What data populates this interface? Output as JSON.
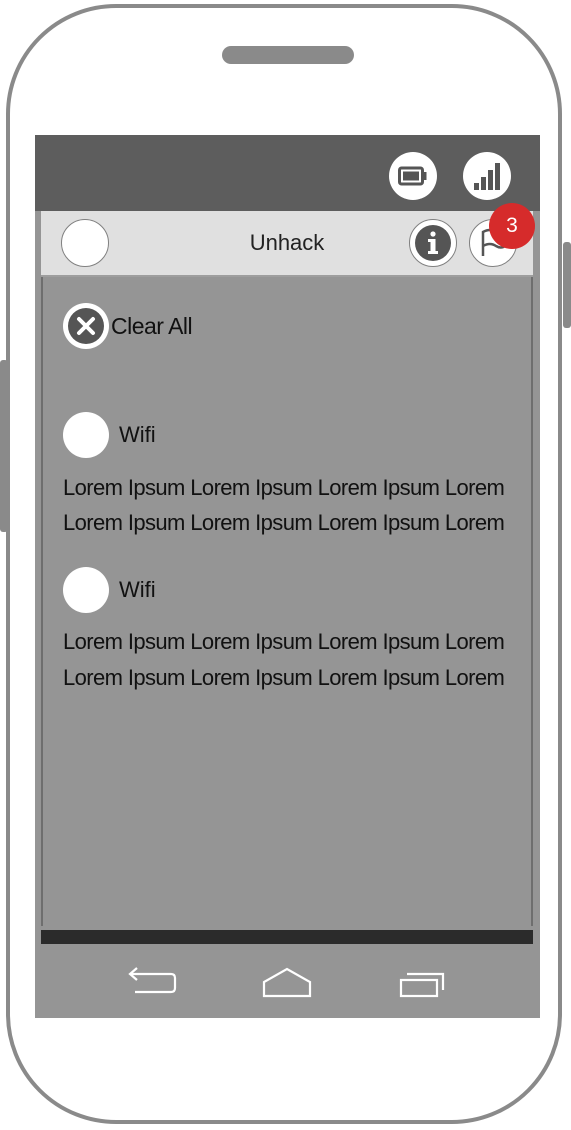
{
  "status_bar": {
    "icons": [
      "battery-icon",
      "signal-icon"
    ]
  },
  "app_bar": {
    "title": "Unhack",
    "info_icon": "info-icon",
    "notifications_icon": "flag-icon",
    "notification_badge": "3",
    "badge_color": "#d62b2b"
  },
  "actions": {
    "clear_all_label": "Clear All",
    "clear_all_icon": "close-circle-icon"
  },
  "notifications": [
    {
      "title": "Wifi",
      "lines": [
        "Lorem Ipsum Lorem Ipsum Lorem Ipsum Lorem",
        "Lorem Ipsum Lorem Ipsum Lorem Ipsum Lorem"
      ]
    },
    {
      "title": "Wifi",
      "lines": [
        "Lorem Ipsum Lorem Ipsum Lorem Ipsum Lorem",
        "Lorem Ipsum Lorem Ipsum Lorem Ipsum Lorem"
      ]
    }
  ],
  "nav_bar": {
    "icons": [
      "back-icon",
      "home-icon",
      "recent-apps-icon"
    ]
  },
  "colors": {
    "status_bar": "#5d5d5d",
    "app_bar": "#e0e0e0",
    "content_bg": "#959595",
    "device_frame": "#8a8a8a"
  }
}
